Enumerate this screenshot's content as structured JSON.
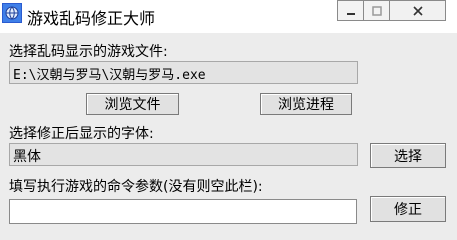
{
  "window": {
    "title": "游戏乱码修正大师",
    "icon": "app-globe-icon",
    "controls": [
      "minimize-icon",
      "maximize-icon",
      "close-icon"
    ]
  },
  "game_file": {
    "label": "选择乱码显示的游戏文件:",
    "path": "E:\\汉朝与罗马\\汉朝与罗马.exe",
    "browse_file_button": "浏览文件",
    "browse_process_button": "浏览进程"
  },
  "font": {
    "label": "选择修正后显示的字体:",
    "value": "黑体",
    "choose_button": "选择"
  },
  "params": {
    "label": "填写执行游戏的命令参数(没有则空此栏):",
    "value": "",
    "fix_button": "修正"
  }
}
